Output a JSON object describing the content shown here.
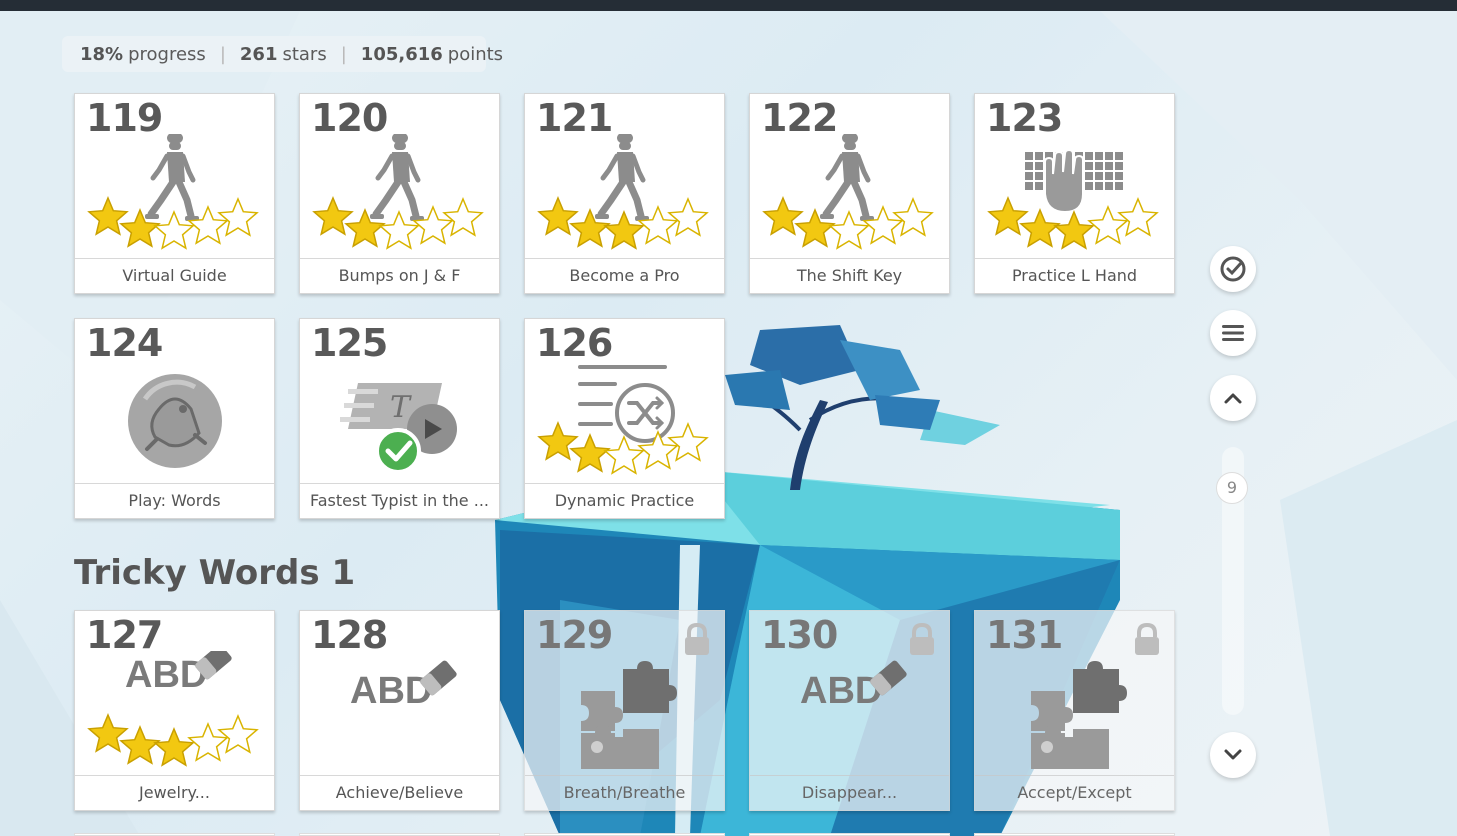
{
  "stats": {
    "progress_value": "18%",
    "progress_label": "progress",
    "stars_value": "261",
    "stars_label": "stars",
    "points_value": "105,616",
    "points_label": "points",
    "separator": "|"
  },
  "section_title": "Tricky Words 1",
  "lessons": [
    {
      "num": "119",
      "label": "Virtual Guide",
      "icon": "walking-person-icon",
      "stars": 2
    },
    {
      "num": "120",
      "label": "Bumps on J & F",
      "icon": "walking-person-icon",
      "stars": 2
    },
    {
      "num": "121",
      "label": "Become a Pro",
      "icon": "walking-person-icon",
      "stars": 3
    },
    {
      "num": "122",
      "label": "The Shift Key",
      "icon": "walking-person-icon",
      "stars": 2
    },
    {
      "num": "123",
      "label": "Practice L Hand",
      "icon": "keyboard-hand-icon",
      "stars": 3
    },
    {
      "num": "124",
      "label": "Play: Words",
      "icon": "game-creature-icon",
      "stars": 0
    },
    {
      "num": "125",
      "label": "Fastest Typist in the ...",
      "icon": "speed-typing-video-icon",
      "stars": 0
    },
    {
      "num": "126",
      "label": "Dynamic Practice",
      "icon": "shuffle-text-icon",
      "stars": 2
    },
    {
      "num": "127",
      "label": "Jewelry...",
      "icon": "abc-eraser-icon",
      "stars": 3
    },
    {
      "num": "128",
      "label": "Achieve/Believe",
      "icon": "abc-eraser-icon",
      "stars": 0
    },
    {
      "num": "129",
      "label": "Breath/Breathe",
      "icon": "puzzle-icon",
      "stars": 0,
      "locked": true
    },
    {
      "num": "130",
      "label": "Disappear...",
      "icon": "abc-eraser-icon",
      "stars": 0,
      "locked": true
    },
    {
      "num": "131",
      "label": "Accept/Except",
      "icon": "puzzle-icon",
      "stars": 0,
      "locked": true
    }
  ],
  "abc_text": "ABD",
  "typing_letter": "T",
  "side_controls": {
    "checklist_icon": "check-circle-icon",
    "menu_icon": "hamburger-menu-icon",
    "up_icon": "chevron-up-icon",
    "down_icon": "chevron-down-icon",
    "page_indicator": "9"
  },
  "colors": {
    "star_gold": "#f2c811",
    "star_empty": "#ffffff",
    "icon_gray": "#8c8c8c",
    "check_green": "#4caf50",
    "topbar": "#252d36"
  }
}
